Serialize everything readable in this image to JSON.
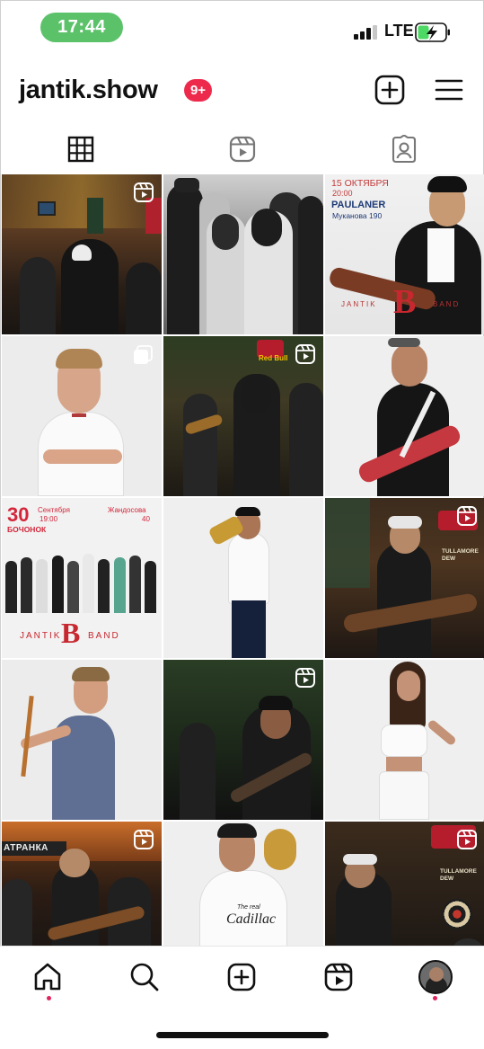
{
  "status_bar": {
    "time": "17:44",
    "network": "LTE",
    "signal_icon": "signal-bars-icon",
    "battery_icon": "battery-charging-icon",
    "time_pill_color": "#5cc26a"
  },
  "header": {
    "username": "jantik.show",
    "notification_badge": "9+",
    "badge_color": "#ed2a4c",
    "new_post_icon": "plus-square-icon",
    "menu_icon": "hamburger-menu-icon"
  },
  "tabs": [
    {
      "name": "posts",
      "icon": "grid-icon",
      "active": true
    },
    {
      "name": "reels",
      "icon": "reels-icon",
      "active": false
    },
    {
      "name": "tagged",
      "icon": "tagged-person-icon",
      "active": false
    }
  ],
  "posts": {
    "poster_paulaner": {
      "date": "15 ОКТЯБРЯ",
      "time": "20:00",
      "venue": "PAULANER",
      "address": "Муканова 190",
      "band": "JANTIK",
      "band_letter": "B",
      "band_suffix": "BAND"
    },
    "poster_bochonok": {
      "day": "30",
      "month": "Сентября",
      "time": "19:00",
      "venue": "БОЧОНОК",
      "address_street": "Жандосова",
      "address_number": "40",
      "band": "JANTIK",
      "band_letter": "B",
      "band_suffix": "BAND"
    },
    "bar_sign_text": "Red Bull",
    "tullamore_text": "TULLAMORE DEW",
    "cadillac_text": "Cadillac",
    "cadillac_sub": "The real",
    "patranka_text": "АТРАНКА"
  },
  "bottom_nav": {
    "items": [
      "home-icon",
      "search-icon",
      "create-icon",
      "reels-icon",
      "profile-avatar"
    ]
  },
  "accent_colors": {
    "red": "#e0245e",
    "poster_red": "#d3263a"
  }
}
